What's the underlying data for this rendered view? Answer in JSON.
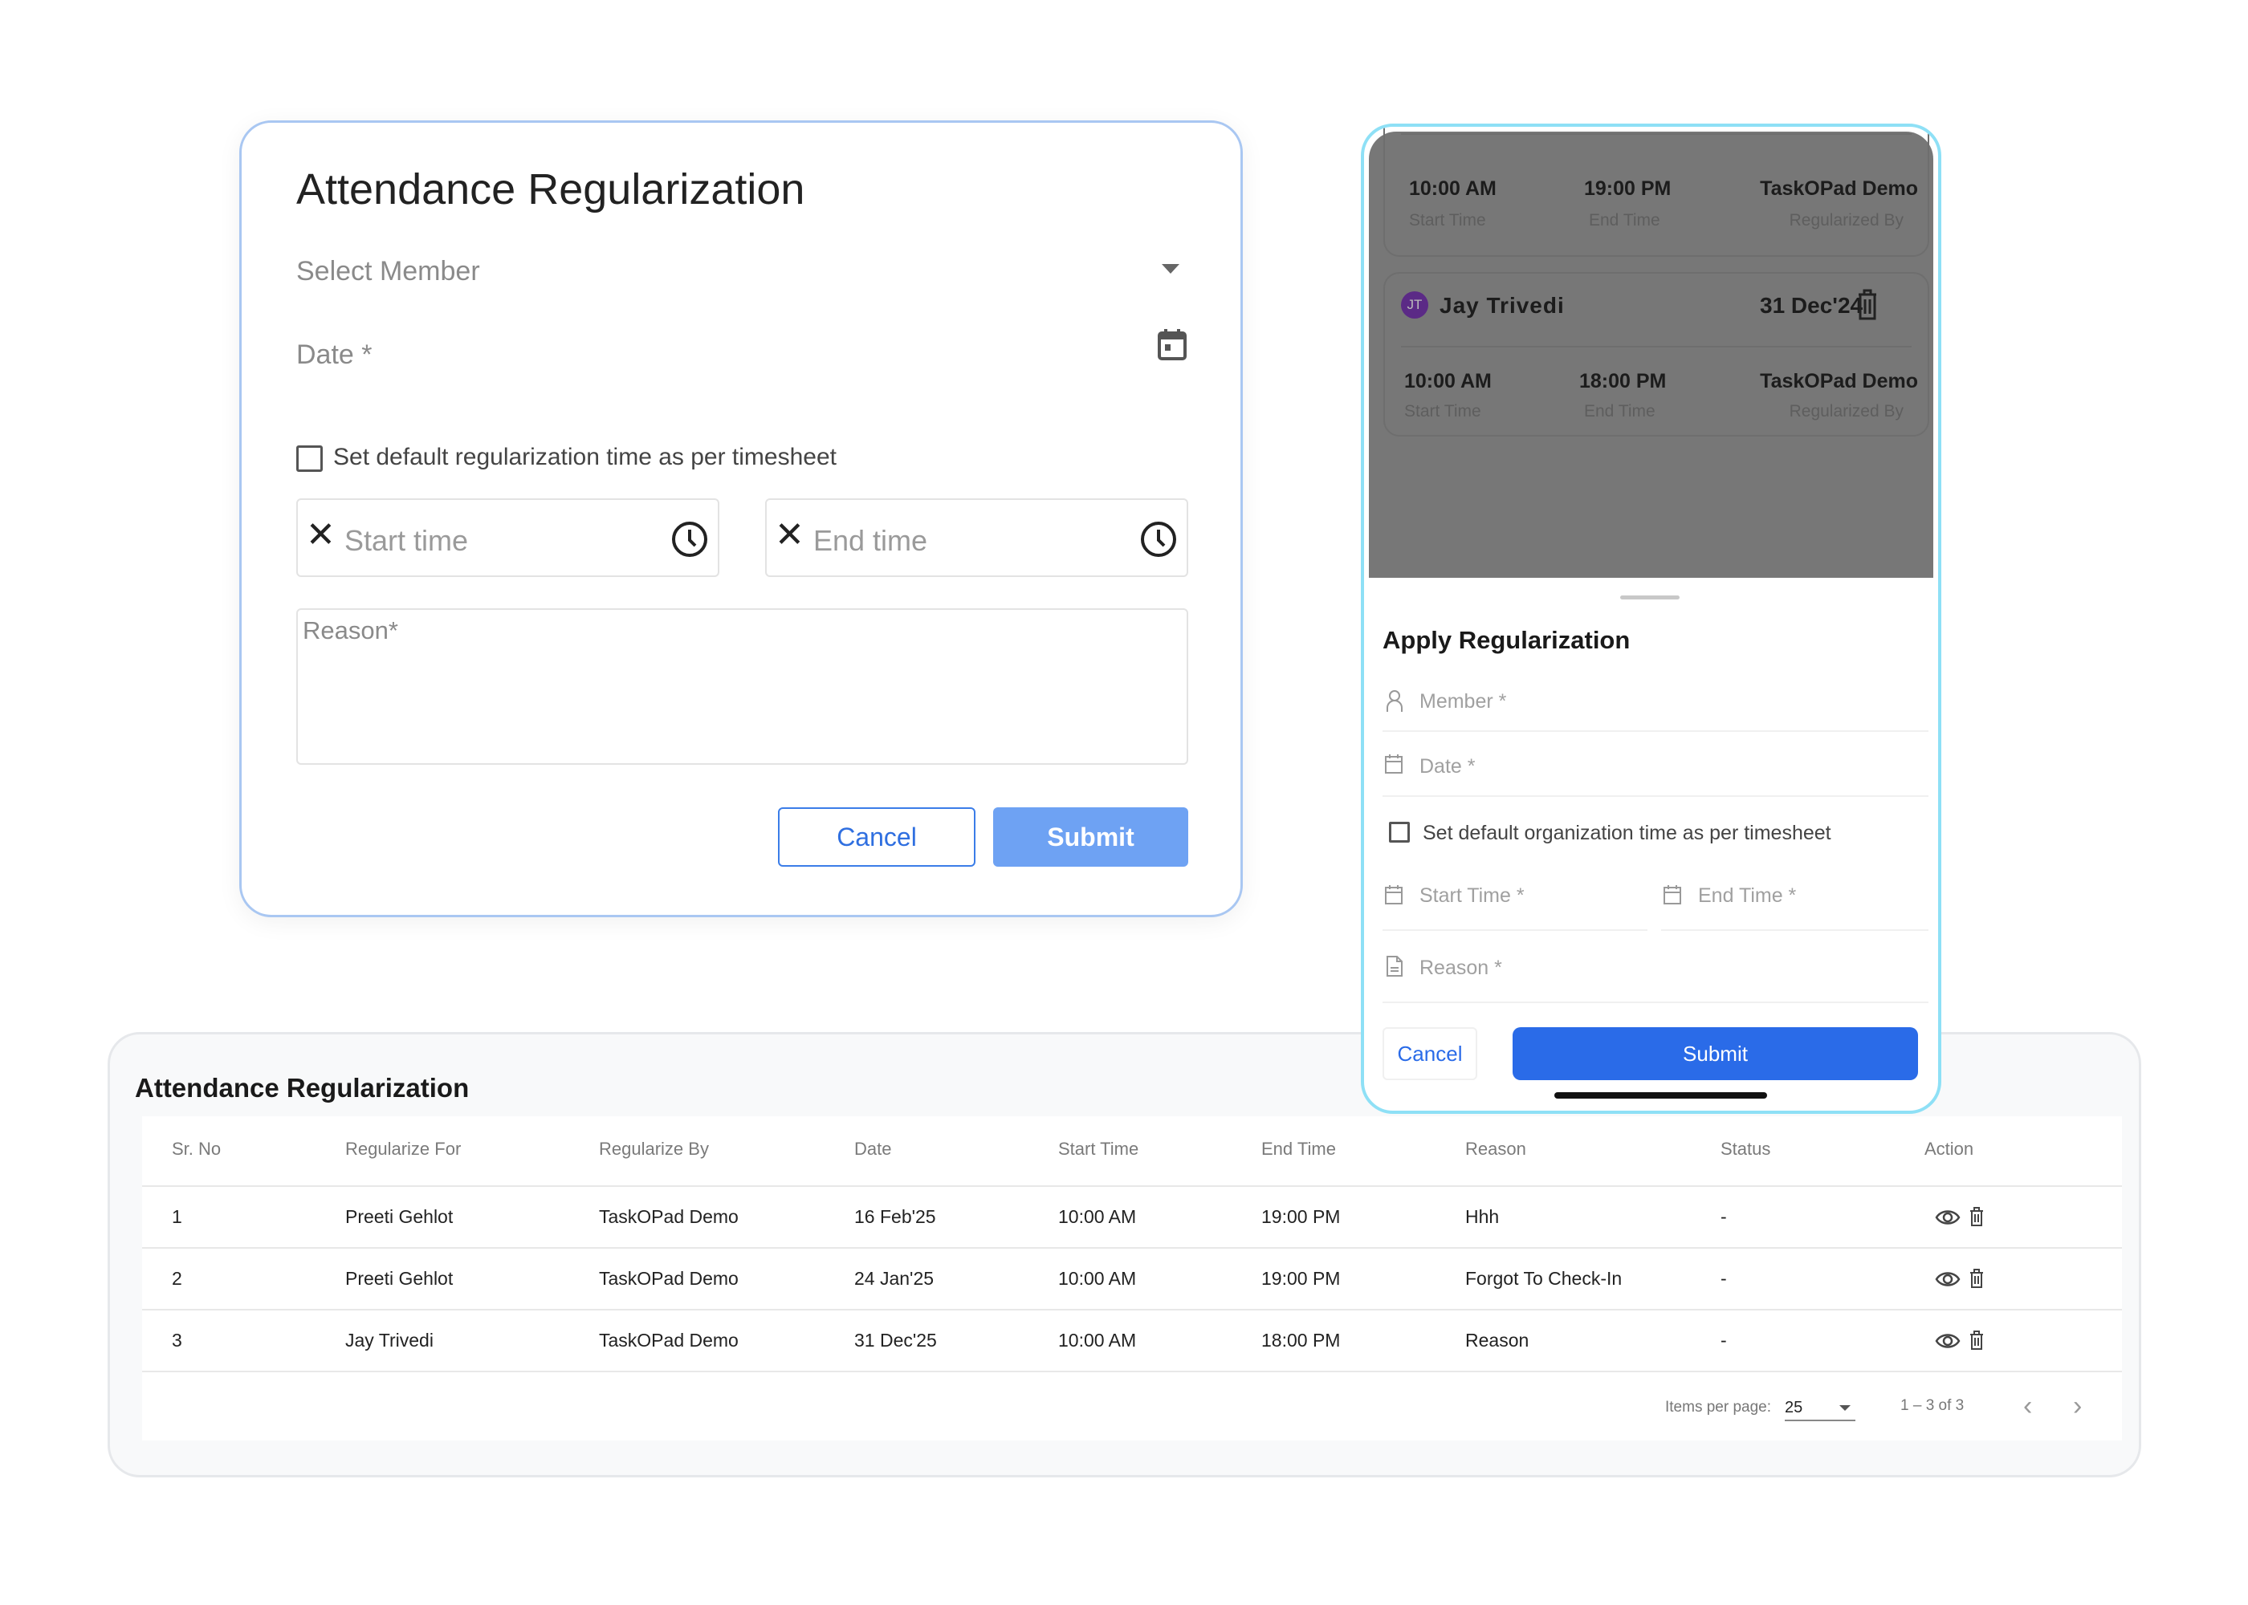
{
  "web_form": {
    "title": "Attendance Regularization",
    "select_member_placeholder": "Select Member",
    "date_label": "Date *",
    "checkbox_label": "Set default regularization time as per timesheet",
    "start_time_placeholder": "Start time",
    "end_time_placeholder": "End time",
    "reason_placeholder": "Reason*",
    "cancel_label": "Cancel",
    "submit_label": "Submit",
    "accent": "#4d8ef0"
  },
  "mobile": {
    "cards": [
      {
        "start": "10:00 AM",
        "start_label": "Start Time",
        "end": "19:00 PM",
        "end_label": "End Time",
        "by": "TaskOPad Demo",
        "by_label": "Regularized By"
      },
      {
        "initials": "JT",
        "name": "Jay Trivedi",
        "date": "31 Dec'24",
        "start": "10:00 AM",
        "start_label": "Start Time",
        "end": "18:00 PM",
        "end_label": "End Time",
        "by": "TaskOPad Demo",
        "by_label": "Regularized By"
      }
    ],
    "sheet": {
      "title": "Apply Regularization",
      "member": "Member *",
      "date": "Date *",
      "checkbox_label": "Set default organization time as per timesheet",
      "start_time": "Start Time *",
      "end_time": "End Time *",
      "reason": "Reason *",
      "cancel_label": "Cancel",
      "submit_label": "Submit"
    },
    "avatar_color": "#5b2a86",
    "submit_color": "#2a6be8"
  },
  "table": {
    "title": "Attendance Regularization",
    "headers": [
      "Sr. No",
      "Regularize For",
      "Regularize By",
      "Date",
      "Start Time",
      "End Time",
      "Reason",
      "Status",
      "Action"
    ],
    "rows": [
      [
        "1",
        "Preeti Gehlot",
        "TaskOPad Demo",
        "16 Feb'25",
        "10:00 AM",
        "19:00 PM",
        "Hhh",
        "-"
      ],
      [
        "2",
        "Preeti Gehlot",
        "TaskOPad Demo",
        "24 Jan'25",
        "10:00 AM",
        "19:00 PM",
        "Forgot To Check-In",
        "-"
      ],
      [
        "3",
        "Jay Trivedi",
        "TaskOPad Demo",
        "31 Dec'25",
        "10:00 AM",
        "18:00 PM",
        "Reason",
        "-"
      ]
    ],
    "pagination": {
      "items_per_page_label": "Items per page:",
      "items_per_page": "25",
      "range": "1 – 3 of 3"
    }
  }
}
